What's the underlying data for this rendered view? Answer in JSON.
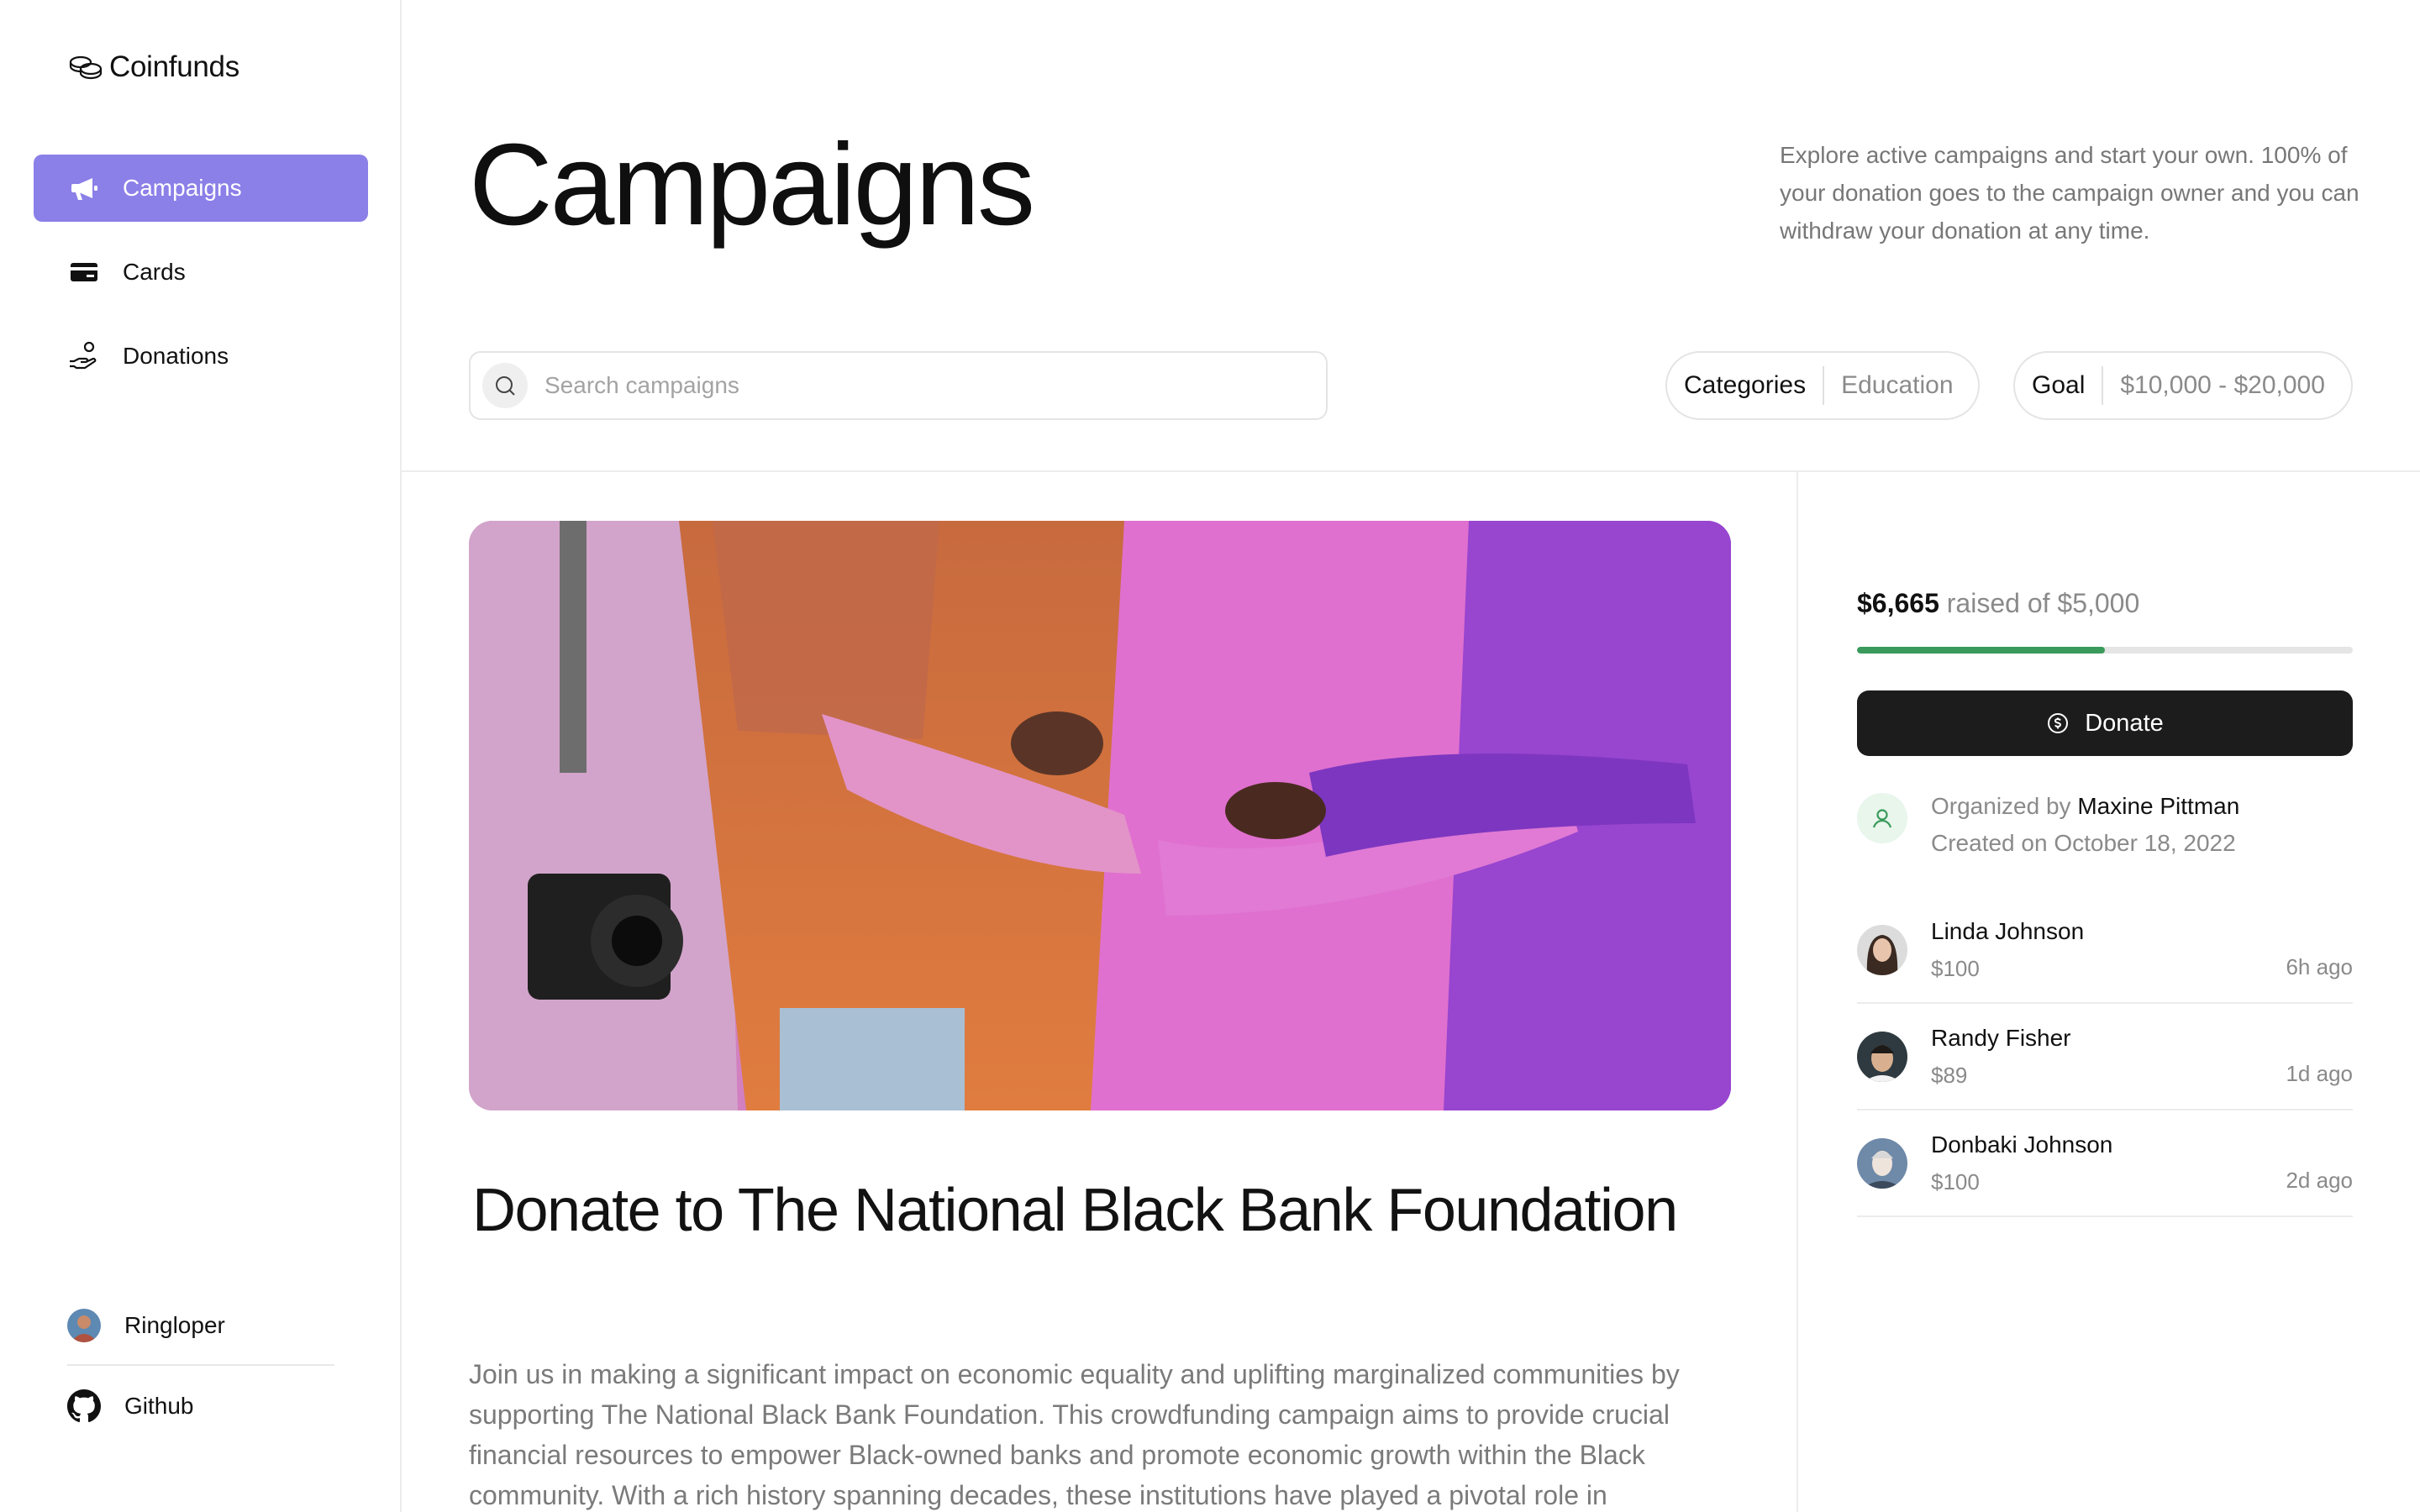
{
  "app": {
    "name": "Coinfunds"
  },
  "sidebar": {
    "items": [
      {
        "label": "Campaigns",
        "icon": "megaphone-icon",
        "active": true
      },
      {
        "label": "Cards",
        "icon": "credit-card-icon",
        "active": false
      },
      {
        "label": "Donations",
        "icon": "hand-coins-icon",
        "active": false
      }
    ],
    "user": {
      "name": "Ringloper"
    },
    "github": {
      "label": "Github"
    }
  },
  "header": {
    "title": "Campaigns",
    "intro": "Explore active campaigns and start your own. 100% of your donation goes to the campaign owner and you can withdraw your donation at any time."
  },
  "search": {
    "placeholder": "Search campaigns",
    "value": ""
  },
  "filters": {
    "categories": {
      "key": "Categories",
      "value": "Education"
    },
    "goal": {
      "key": "Goal",
      "value": "$10,000 - $20,000"
    }
  },
  "campaign": {
    "title": "Donate to The National Black Bank Foundation",
    "description": "Join us in making a significant impact on economic equality and uplifting marginalized communities by supporting The National Black Bank Foundation. This crowdfunding campaign aims to provide crucial financial resources to empower Black-owned banks and promote economic growth within the Black community. With a rich history spanning decades, these institutions have played a pivotal role in"
  },
  "funding": {
    "raised": "$6,665",
    "raised_suffix": "raised of $5,000",
    "progress_fraction": 0.5,
    "progress_color": "#3a9a5b",
    "donate_label": "Donate"
  },
  "organizer": {
    "prefix": "Organized by",
    "name": "Maxine Pittman",
    "created": "Created on October 18, 2022"
  },
  "donors": [
    {
      "name": "Linda Johnson",
      "amount": "$100",
      "time": "6h ago"
    },
    {
      "name": "Randy Fisher",
      "amount": "$89",
      "time": "1d ago"
    },
    {
      "name": "Donbaki Johnson",
      "amount": "$100",
      "time": "2d ago"
    }
  ],
  "colors": {
    "accent": "#8b7fe8",
    "button_dark": "#1c1c1c"
  }
}
